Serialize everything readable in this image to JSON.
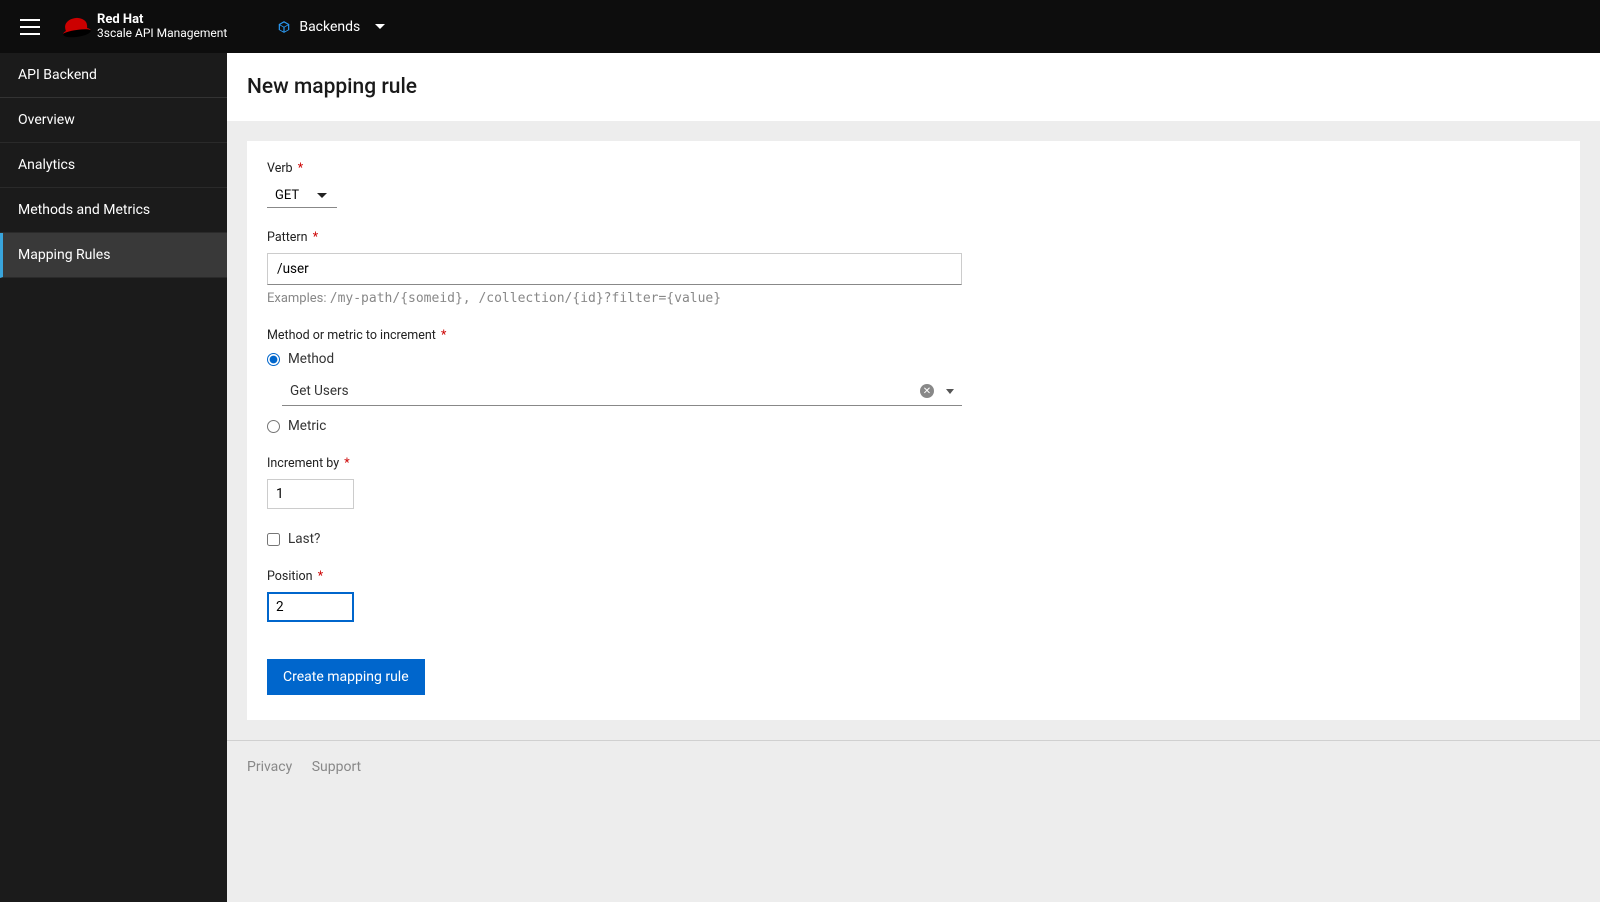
{
  "header": {
    "brand_line1": "Red Hat",
    "brand_line2": "3scale API Management",
    "context_label": "Backends"
  },
  "sidebar": {
    "title": "API Backend",
    "items": [
      {
        "label": "Overview"
      },
      {
        "label": "Analytics"
      },
      {
        "label": "Methods and Metrics"
      },
      {
        "label": "Mapping Rules"
      }
    ]
  },
  "page": {
    "title": "New mapping rule"
  },
  "form": {
    "verb_label": "Verb",
    "verb_value": "GET",
    "pattern_label": "Pattern",
    "pattern_value": "/user",
    "pattern_hint_prefix": "Examples: ",
    "pattern_hint_code": "/my-path/{someid}, /collection/{id}?filter={value}",
    "mm_label": "Method or metric to increment",
    "radio_method": "Method",
    "radio_metric": "Metric",
    "method_value": "Get Users",
    "increment_label": "Increment by",
    "increment_value": "1",
    "last_label": "Last?",
    "position_label": "Position",
    "position_value": "2",
    "submit": "Create mapping rule"
  },
  "footer": {
    "privacy": "Privacy",
    "support": "Support"
  }
}
